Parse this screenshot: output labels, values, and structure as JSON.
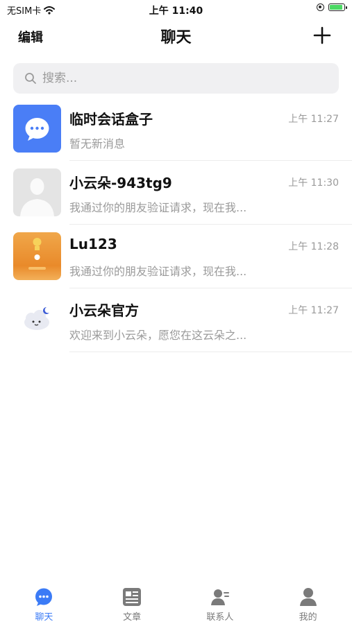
{
  "status": {
    "carrier": "无SIM卡",
    "time": "上午 11:40"
  },
  "nav": {
    "edit_label": "编辑",
    "title": "聊天"
  },
  "search": {
    "placeholder": "搜索..."
  },
  "chats": [
    {
      "name": "临时会话盒子",
      "time": "上午 11:27",
      "preview": "暂无新消息",
      "avatar": "chat-bubble-icon"
    },
    {
      "name": "小云朵-943tg9",
      "time": "上午 11:30",
      "preview": "我通过你的朋友验证请求，现在我...",
      "avatar": "default-person-avatar"
    },
    {
      "name": "Lu123",
      "time": "上午 11:28",
      "preview": "我通过你的朋友验证请求，现在我...",
      "avatar": "orange-photo-avatar"
    },
    {
      "name": "小云朵官方",
      "time": "上午 11:27",
      "preview": "欢迎来到小云朵，愿您在这云朵之...",
      "avatar": "cloud-mascot-avatar"
    }
  ],
  "tabs": [
    {
      "label": "聊天",
      "icon": "chat-bubble-icon",
      "active": true
    },
    {
      "label": "文章",
      "icon": "article-icon",
      "active": false
    },
    {
      "label": "联系人",
      "icon": "contacts-icon",
      "active": false
    },
    {
      "label": "我的",
      "icon": "profile-icon",
      "active": false
    }
  ],
  "colors": {
    "accent": "#3b7bf6",
    "inactive": "#7a7a7a",
    "subtext": "#9a9a9a"
  }
}
